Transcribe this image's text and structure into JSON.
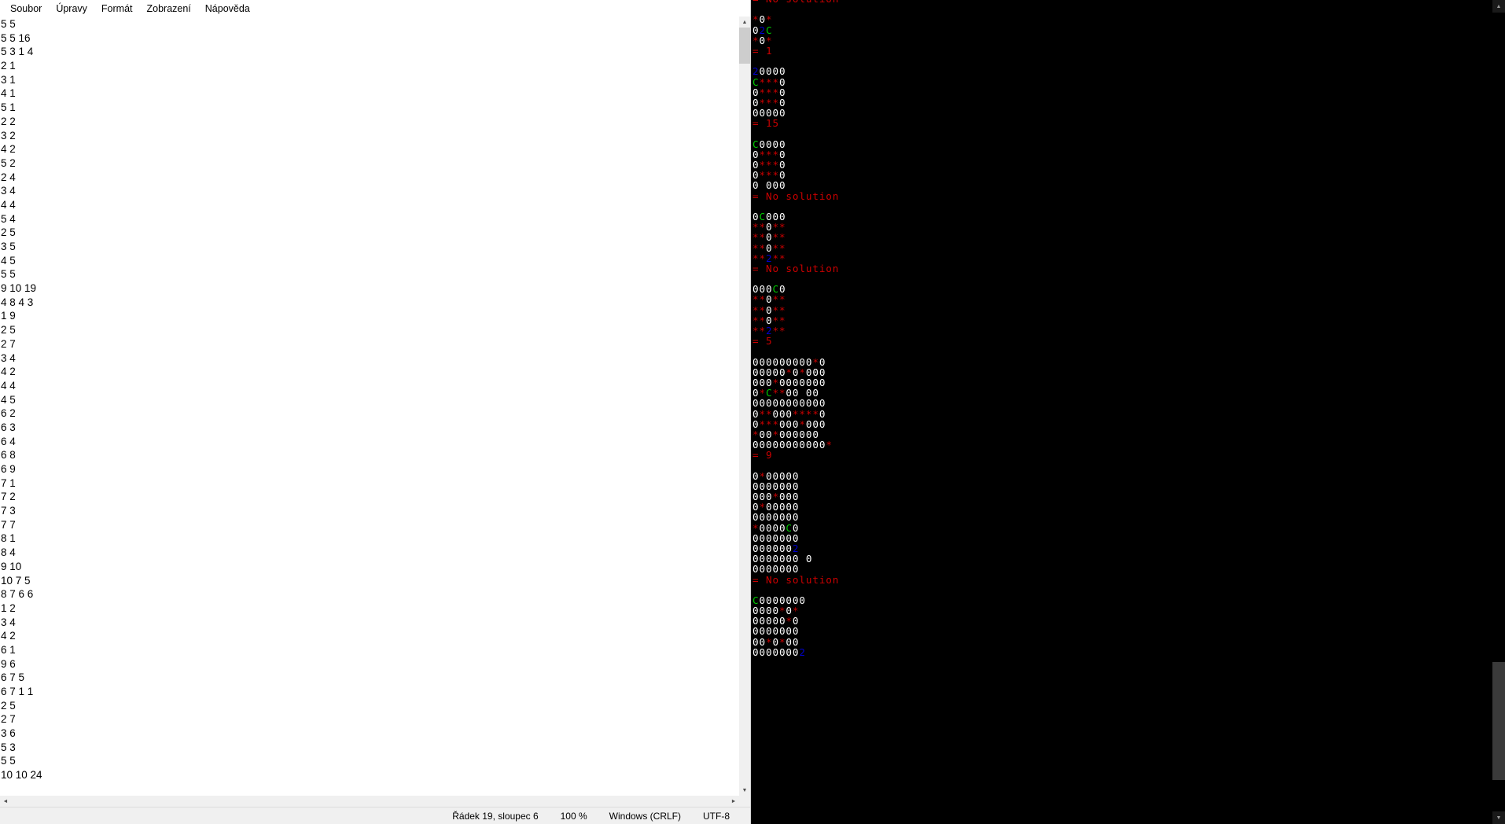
{
  "notepad": {
    "menu": [
      {
        "label": "Soubor",
        "accel": "S"
      },
      {
        "label": "Úpravy",
        "accel": "a"
      },
      {
        "label": "Formát",
        "accel": "F"
      },
      {
        "label": "Zobrazení",
        "accel": "Z"
      },
      {
        "label": "Nápověda",
        "accel": "ě"
      }
    ],
    "lines": [
      "5 5",
      "5 5 16",
      "5 3 1 4",
      "2 1",
      "3 1",
      "4 1",
      "5 1",
      "2 2",
      "3 2",
      "4 2",
      "5 2",
      "2 4",
      "3 4",
      "4 4",
      "5 4",
      "2 5",
      "3 5",
      "4 5",
      "5 5",
      "9 10 19",
      "4 8 4 3",
      "1 9",
      "2 5",
      "2 7",
      "3 4",
      "4 2",
      "4 4",
      "4 5",
      "6 2",
      "6 3",
      "6 4",
      "6 8",
      "6 9",
      "7 1",
      "7 2",
      "7 3",
      "7 7",
      "8 1",
      "8 4",
      "9 10",
      "10 7 5",
      "8 7 6 6",
      "1 2",
      "3 4",
      "4 2",
      "6 1",
      "9 6",
      "6 7 5",
      "6 7 1 1",
      "2 5",
      "2 7",
      "3 6",
      "5 3",
      "5 5",
      "10 10 24"
    ],
    "status": {
      "position": "Řádek 19, sloupec 6",
      "zoom": "100 %",
      "eol": "Windows (CRLF)",
      "encoding": "UTF-8"
    },
    "scroll": {
      "up_arrow": "▲",
      "down_arrow": "▼",
      "left_arrow": "◄",
      "right_arrow": "►"
    }
  },
  "console": {
    "legend": {
      "empty_cell": "0",
      "wall_cell": "*",
      "start_cell": "C",
      "marker_cell": "2"
    },
    "colors": {
      "background": "#000000",
      "empty": "#ffffff",
      "wall": "#cc0000",
      "start": "#00cc00",
      "marker": "#0000cc",
      "result": "#cc0000"
    },
    "scroll": {
      "up_arrow": "▲",
      "down_arrow": "▼"
    },
    "blocks": [
      {
        "result": "= No solution",
        "result_before": true,
        "grid": []
      },
      {
        "grid": [
          "*0*",
          "02C",
          "*0*"
        ],
        "result": "= 1"
      },
      {
        "grid": [
          "20000",
          "C***0",
          "0***0",
          "0***0",
          "00000"
        ],
        "result": "= 15"
      },
      {
        "grid": [
          "C0000",
          "0***0",
          "0***0",
          "0***0",
          "0 000"
        ],
        "result": "= No solution"
      },
      {
        "grid": [
          "0C000",
          "**0**",
          "**0**",
          "**0**",
          "**2**"
        ],
        "result": "= No solution"
      },
      {
        "grid": [
          "000C0",
          "**0**",
          "**0**",
          "**0**",
          "**2**"
        ],
        "result": "= 5"
      },
      {
        "grid": [
          "000000000*0",
          "00000*0*000",
          "000*0000000",
          "0*C**00 00",
          "00000000000",
          "0**000****0",
          "0***000*000",
          "*00*000000",
          "00000000000*"
        ],
        "result": "= 9"
      },
      {
        "grid": [
          "0*00000",
          "0000000",
          "000*000",
          "0*00000",
          "0000000",
          "*0000C0",
          "0000000",
          "0000002",
          "0000000 0",
          "0000000"
        ],
        "result": "= No solution"
      },
      {
        "grid": [
          "C0000000",
          "0000*0*",
          "00000*0",
          "0000000",
          "00*0*00",
          "00000002"
        ],
        "result": ""
      }
    ],
    "raw_lines": [
      {
        "text": "= No solution",
        "type": "result"
      },
      {
        "text": "",
        "type": "blank"
      },
      {
        "text": "*0*",
        "type": "grid"
      },
      {
        "text": "02C",
        "type": "grid"
      },
      {
        "text": "*0*",
        "type": "grid"
      },
      {
        "text": "= 1",
        "type": "result"
      },
      {
        "text": "",
        "type": "blank"
      },
      {
        "text": "20000",
        "type": "grid"
      },
      {
        "text": "C***0",
        "type": "grid"
      },
      {
        "text": "0***0",
        "type": "grid"
      },
      {
        "text": "0***0",
        "type": "grid"
      },
      {
        "text": "00000",
        "type": "grid"
      },
      {
        "text": "= 15",
        "type": "result"
      },
      {
        "text": "",
        "type": "blank"
      },
      {
        "text": "C0000",
        "type": "grid"
      },
      {
        "text": "0***0",
        "type": "grid"
      },
      {
        "text": "0***0",
        "type": "grid"
      },
      {
        "text": "0***0",
        "type": "grid"
      },
      {
        "text": "0 000",
        "type": "grid"
      },
      {
        "text": "= No solution",
        "type": "result"
      },
      {
        "text": "",
        "type": "blank"
      },
      {
        "text": "0C000",
        "type": "grid"
      },
      {
        "text": "**0**",
        "type": "grid"
      },
      {
        "text": "**0**",
        "type": "grid"
      },
      {
        "text": "**0**",
        "type": "grid"
      },
      {
        "text": "**2**",
        "type": "grid"
      },
      {
        "text": "= No solution",
        "type": "result"
      },
      {
        "text": "",
        "type": "blank"
      },
      {
        "text": "000C0",
        "type": "grid"
      },
      {
        "text": "**0**",
        "type": "grid"
      },
      {
        "text": "**0**",
        "type": "grid"
      },
      {
        "text": "**0**",
        "type": "grid"
      },
      {
        "text": "**2**",
        "type": "grid"
      },
      {
        "text": "= 5",
        "type": "result"
      }
    ]
  }
}
